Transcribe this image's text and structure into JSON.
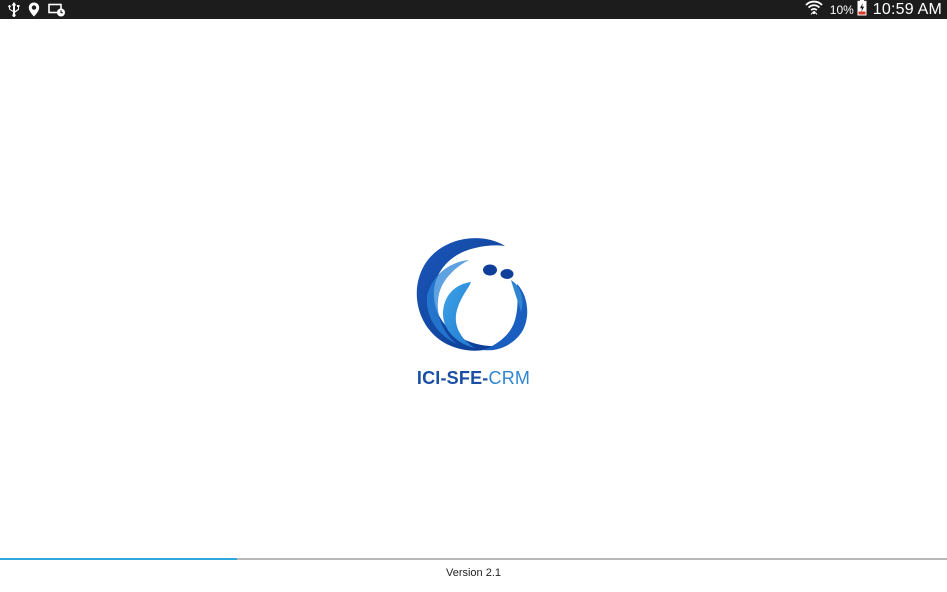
{
  "status_bar": {
    "icons_left": [
      "usb-icon",
      "location-icon",
      "cast-schedule-icon"
    ],
    "icons_right": [
      "wifi-icon",
      "battery-icon"
    ],
    "battery_percent": "10%",
    "time": "10:59 AM"
  },
  "splash": {
    "logo": "app-logo",
    "app_name_part1": "ICI-SFE-",
    "app_name_part2": "CRM",
    "colors": {
      "brand_dark": "#1b4fa3",
      "brand_light": "#2f86d0"
    }
  },
  "loading": {
    "progress": 0.25,
    "color": "#2fa7dc"
  },
  "footer": {
    "version": "Version 2.1"
  }
}
